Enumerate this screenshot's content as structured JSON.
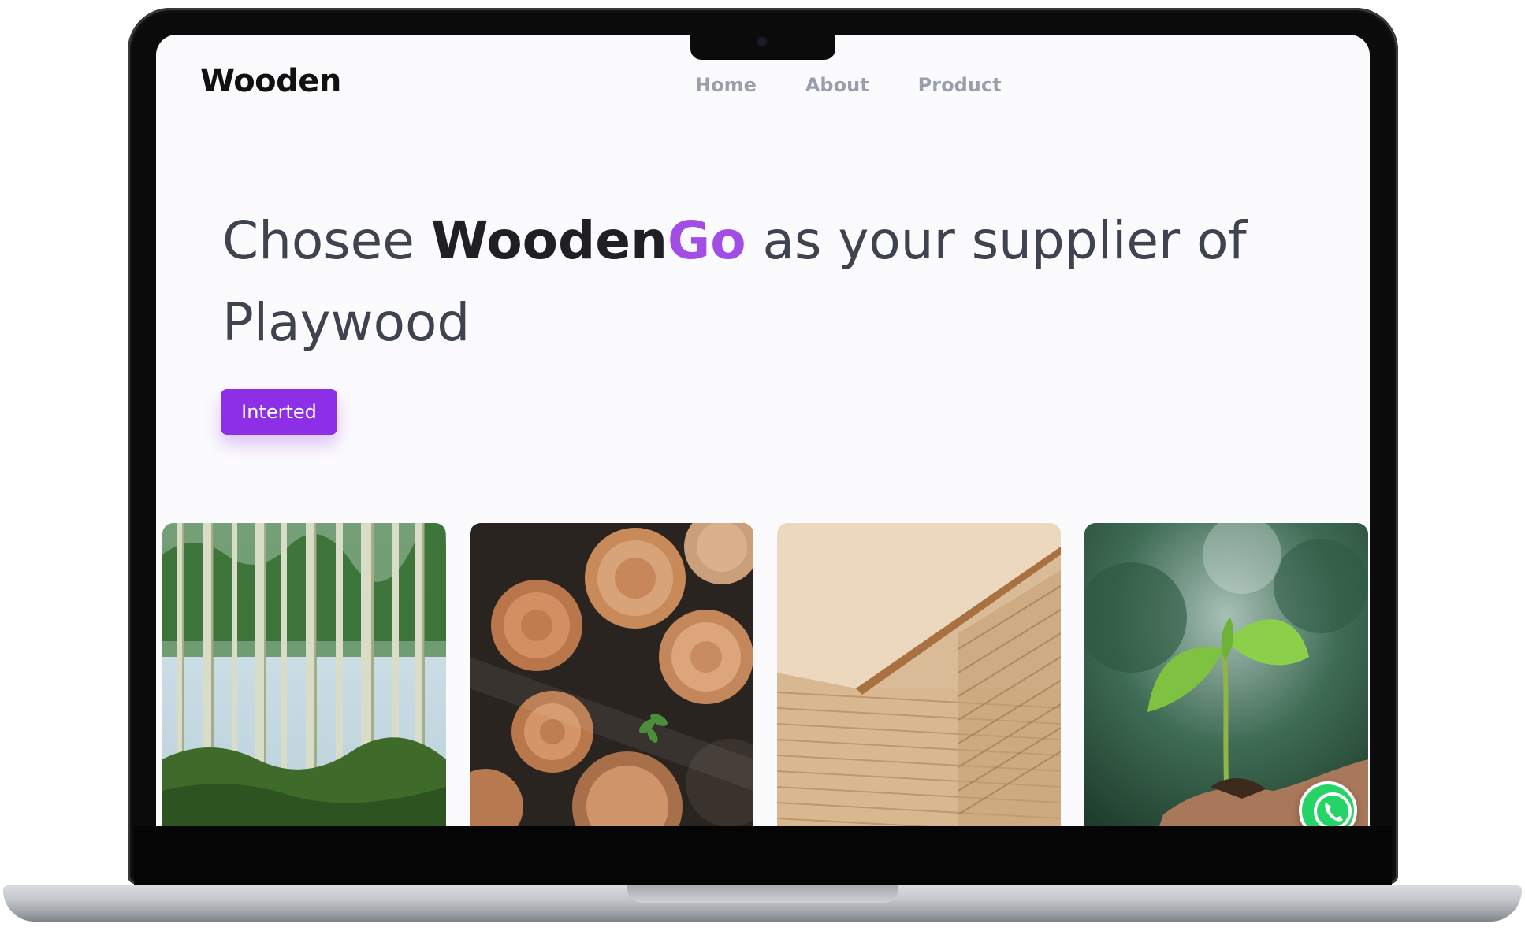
{
  "site": {
    "brand": "Wooden",
    "nav": [
      "Home",
      "About",
      "Product"
    ]
  },
  "hero": {
    "prefix": "Chosee ",
    "brand_bold": "Wooden",
    "brand_accent": "Go",
    "suffix": " as your supplier of Playwood",
    "button_label": "Interted"
  },
  "gallery": [
    {
      "name": "forest-trees",
      "image": "tall forest trees"
    },
    {
      "name": "log-stack",
      "image": "stacked cut logs"
    },
    {
      "name": "plywood-sheets",
      "image": "stacked plywood sheets"
    },
    {
      "name": "seedling",
      "image": "seedling in hand"
    }
  ],
  "floating": {
    "icon": "whatsapp-phone-icon"
  },
  "colors": {
    "accent": "#8d2fe6",
    "accent_text": "#a14de6",
    "nav_text": "#9aa0ab",
    "hero_text": "#3f4350"
  }
}
